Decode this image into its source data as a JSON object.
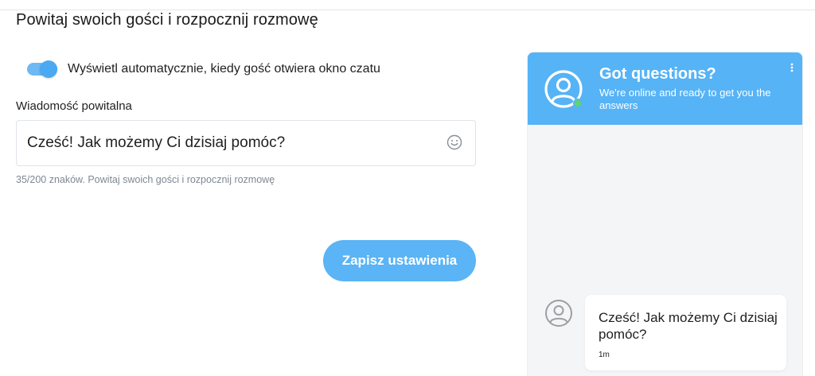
{
  "section": {
    "title": "Powitaj swoich gości i rozpocznij rozmowę"
  },
  "auto_display": {
    "enabled": true,
    "label": "Wyświetl automatycznie, kiedy gość otwiera okno czatu"
  },
  "welcome_message": {
    "label": "Wiadomość powitalna",
    "value": "Cześć! Jak możemy Ci dzisiaj pomóc?",
    "helper": "35/200 znaków. Powitaj swoich gości i rozpocznij rozmowę"
  },
  "save_button": {
    "label": "Zapisz ustawienia"
  },
  "chat_preview": {
    "title": "Got questions?",
    "subtitle": "We're online and ready to get you the answers",
    "message": {
      "text": "Cześć! Jak możemy Ci dzisiaj pomóc?",
      "time": "1m"
    }
  },
  "icons": {
    "toggle": "toggle-switch",
    "emoji": "smiley-icon",
    "agent_avatar": "user-avatar-icon",
    "online_status": "online-dot",
    "menu": "vertical-dots-icon"
  },
  "colors": {
    "accent": "#56b3f6",
    "toggle": "#4aa9f2",
    "online": "#5fd56a",
    "helper_text": "#7d8894"
  }
}
